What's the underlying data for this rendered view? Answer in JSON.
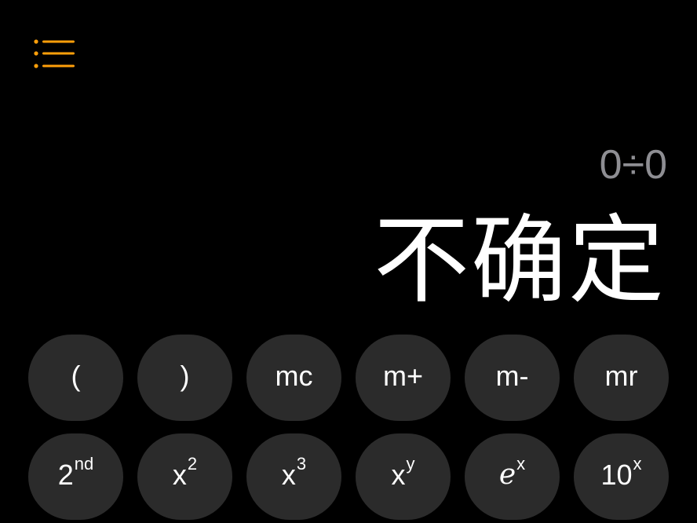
{
  "colors": {
    "background": "#000000",
    "accent": "#ff9f0a",
    "key_background": "#2b2b2b",
    "key_text": "#ffffff",
    "expression_text": "#8e8e93",
    "result_text": "#ffffff"
  },
  "header": {
    "menu_icon": "list-bullet-icon"
  },
  "display": {
    "expression": "0÷0",
    "result": "不确定"
  },
  "keypad": {
    "row1": [
      {
        "label": "("
      },
      {
        "label": ")"
      },
      {
        "label": "mc"
      },
      {
        "label": "m+"
      },
      {
        "label": "m-"
      },
      {
        "label": "mr"
      }
    ],
    "row2": [
      {
        "base": "2",
        "sup": "nd"
      },
      {
        "base": "x",
        "sup": "2"
      },
      {
        "base": "x",
        "sup": "3"
      },
      {
        "base": "x",
        "sup": "y"
      },
      {
        "base": "e",
        "sup": "x"
      },
      {
        "base": "10",
        "sup": "x"
      }
    ]
  }
}
